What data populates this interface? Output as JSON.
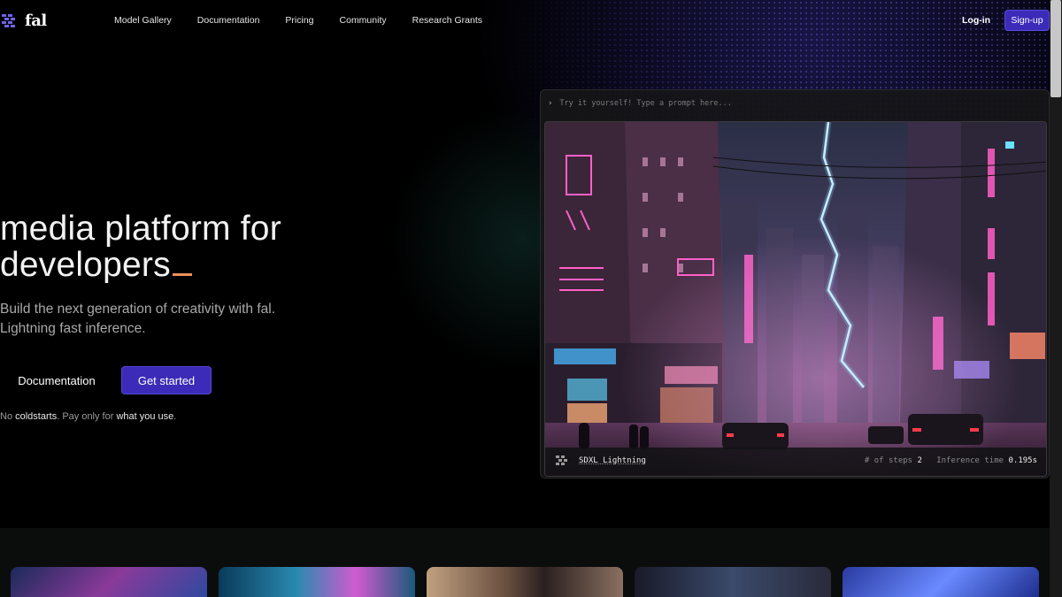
{
  "nav": {
    "brand": "fal",
    "links": [
      "Model Gallery",
      "Documentation",
      "Pricing",
      "Community",
      "Research Grants"
    ],
    "login": "Log-in",
    "signup": "Sign-up"
  },
  "hero": {
    "title_line1": "media platform for",
    "title_line2": "developers",
    "subtitle_line1": "Build the next generation of creativity with fal.",
    "subtitle_line2": "Lightning fast inference.",
    "btn_docs": "Documentation",
    "btn_start": "Get started",
    "note": {
      "p1": "No ",
      "h1": "coldstarts",
      "p2": ". Pay only for ",
      "h2": "what you use",
      "p3": "."
    }
  },
  "demo": {
    "caret": "›",
    "placeholder": "Try it yourself! Type a prompt here...",
    "model": "SDXL Lightning",
    "steps_label": "# of steps",
    "steps_value": "2",
    "time_label": "Inference time",
    "time_value": "0.195s"
  },
  "colors": {
    "accent": "#3b2bb8",
    "cursor": "#f0915b"
  }
}
